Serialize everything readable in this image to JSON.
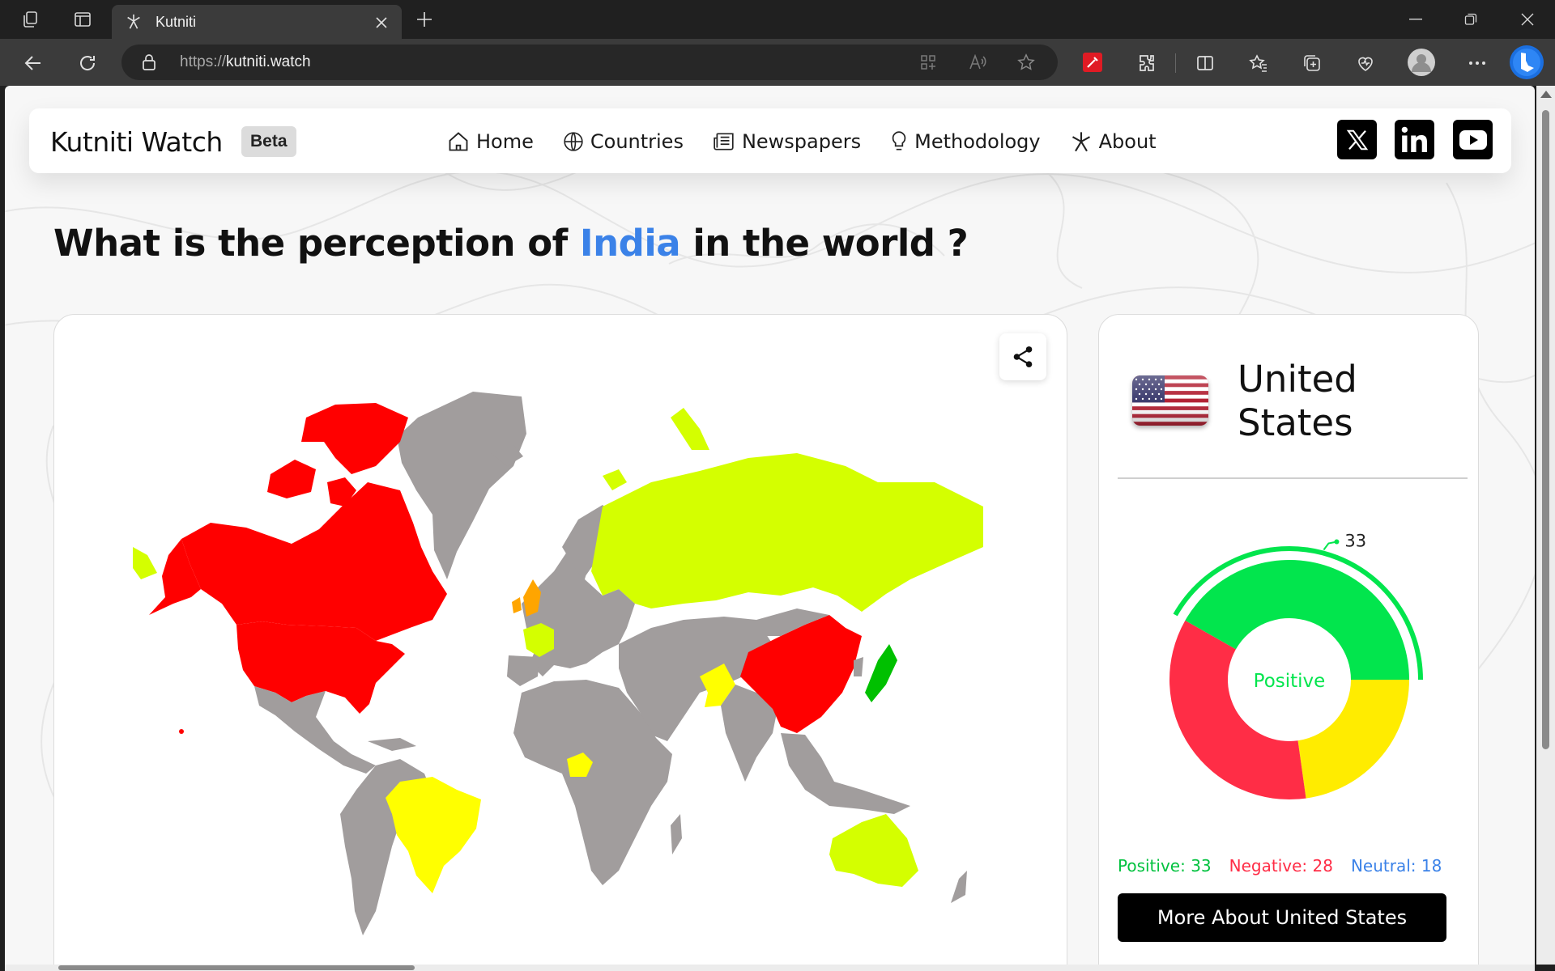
{
  "browser": {
    "tab_title": "Kutniti",
    "url_prefix": "https://",
    "url_host": "kutniti.watch"
  },
  "site": {
    "brand": "Kutniti Watch",
    "badge": "Beta",
    "nav": [
      {
        "label": "Home",
        "icon": "home-icon"
      },
      {
        "label": "Countries",
        "icon": "globe-icon"
      },
      {
        "label": "Newspapers",
        "icon": "newspaper-icon"
      },
      {
        "label": "Methodology",
        "icon": "lightbulb-icon"
      },
      {
        "label": "About",
        "icon": "logo-icon"
      }
    ],
    "social": [
      "x-icon",
      "linkedin-icon",
      "youtube-icon"
    ]
  },
  "headline": {
    "before": "What is the perception of ",
    "highlight": "India",
    "after": " in the world ?"
  },
  "colors": {
    "positive": "#02e54d",
    "negative": "#ff2d46",
    "neutral": "#ffec00",
    "neutral_label": "#3b82e8",
    "map_red": "#ff0000",
    "map_lime": "#d4ff00",
    "map_yellow": "#ffff00",
    "map_orange": "#ffa500",
    "map_green": "#00c000",
    "map_grey": "#a19d9d",
    "highlight": "#3b82e8"
  },
  "country_panel": {
    "name": "United States",
    "flag": "us-flag-icon",
    "center_label": "Positive",
    "callout_value": "33",
    "stats": {
      "positive": "Positive: 33",
      "negative": "Negative: 28",
      "neutral": "Neutral: 18"
    },
    "button_label": "More About United States"
  },
  "chart_data": {
    "type": "pie",
    "categories": [
      "Positive",
      "Neutral",
      "Negative"
    ],
    "values": [
      33,
      18,
      28
    ],
    "colors": [
      "#02e54d",
      "#ffec00",
      "#ff2d46"
    ]
  }
}
